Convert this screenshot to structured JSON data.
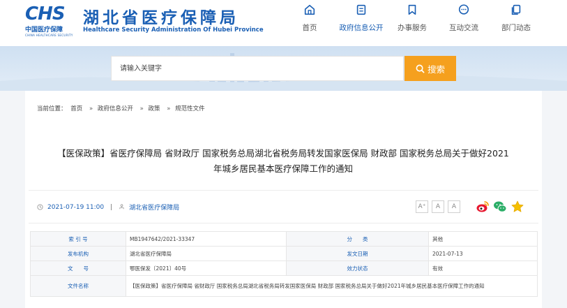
{
  "header": {
    "logo_mark": "CHS",
    "logo_cn": "中国医疗保障",
    "logo_en": "CHINA HEALTHCARE SECURITY",
    "title": "湖北省医疗保障局",
    "subtitle": "Healthcare Security Administration Of Hubei Province",
    "brand_color": "#1a5fb4"
  },
  "nav": [
    {
      "label": "首页",
      "icon": "home-icon"
    },
    {
      "label": "政府信息公开",
      "icon": "document-icon",
      "active": true
    },
    {
      "label": "办事服务",
      "icon": "bookmark-icon"
    },
    {
      "label": "互动交流",
      "icon": "chat-icon"
    },
    {
      "label": "部门动态",
      "icon": "copy-icon"
    }
  ],
  "search": {
    "placeholder": "请输入关键字",
    "button_label": "搜索",
    "button_color": "#f5a01e"
  },
  "breadcrumb": {
    "prefix": "当前位置：",
    "items": [
      "首页",
      "政府信息公开",
      "政策",
      "规范性文件"
    ],
    "separator": "»"
  },
  "article": {
    "title": "【医保政策】省医疗保障局 省财政厅 国家税务总局湖北省税务局转发国家医保局 财政部 国家税务总局关于做好2021年城乡居民基本医疗保障工作的通知",
    "date": "2021-07-19 11:00",
    "source": "湖北省医疗保障局"
  },
  "font_sizes": [
    "A⁺",
    "A",
    "A"
  ],
  "share": [
    "weibo-icon",
    "wechat-icon",
    "favorite-star-icon"
  ],
  "info_table": {
    "index_label": "索 引 号",
    "index_value": "MB1947642/2021-33347",
    "category_label": "分　　类",
    "category_value": "其他",
    "issuer_label": "发布机构",
    "issuer_value": "湖北省医疗保障局",
    "issue_date_label": "发文日期",
    "issue_date_value": "2021-07-13",
    "doc_no_label": "文　　号",
    "doc_no_value": "鄂医保发〔2021〕40号",
    "status_label": "效力状态",
    "status_value": "有效",
    "name_label": "文件名称",
    "name_value": "【医保政策】省医疗保障局 省财政厅 国家税务总局湖北省税务局转发国家医保局 财政部 国家税务总局关于做好2021年城乡居民基本医疗保障工作的通知"
  }
}
